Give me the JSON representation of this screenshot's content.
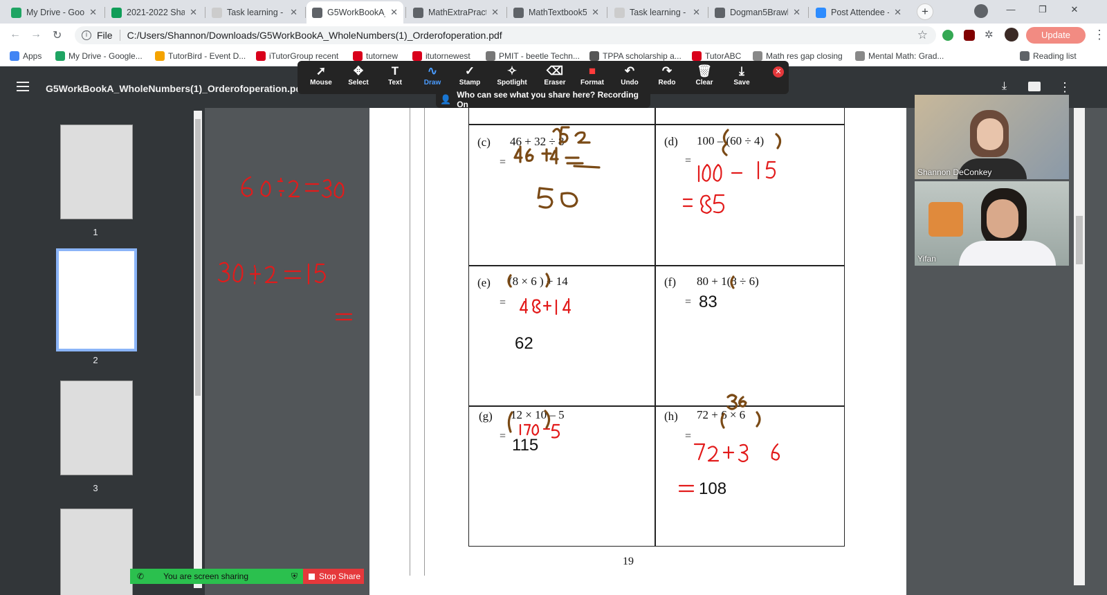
{
  "browser": {
    "tabs": [
      {
        "label": "My Drive - Goo",
        "color": "#1fa463"
      },
      {
        "label": "2021-2022 Sha",
        "color": "#0f9d58"
      },
      {
        "label": "Task learning -",
        "color": "#cccccc"
      },
      {
        "label": "G5WorkBookA_",
        "color": "#5f6368"
      },
      {
        "label": "MathExtraPract",
        "color": "#5f6368"
      },
      {
        "label": "MathTextbook5",
        "color": "#5f6368"
      },
      {
        "label": "Task learning -",
        "color": "#cccccc"
      },
      {
        "label": "Dogman5Brawl",
        "color": "#5f6368"
      },
      {
        "label": "Post Attendee -",
        "color": "#2d8cff"
      }
    ],
    "close_glyph": "✕",
    "new_tab": "+",
    "address": {
      "scheme_label": "File",
      "url": "C:/Users/Shannon/Downloads/G5WorkBookA_WholeNumbers(1)_Orderofoperation.pdf"
    },
    "update_button": "Update",
    "bookmarks": [
      {
        "label": "Apps",
        "color": "#4285f4"
      },
      {
        "label": "My Drive - Google...",
        "color": "#1fa463"
      },
      {
        "label": "TutorBird - Event D...",
        "color": "#f4a300"
      },
      {
        "label": "iTutorGroup recent",
        "color": "#d9001b"
      },
      {
        "label": "tutornew",
        "color": "#d9001b"
      },
      {
        "label": "itutornewest",
        "color": "#d9001b"
      },
      {
        "label": "PMIT - beetle Techn...",
        "color": "#777777"
      },
      {
        "label": "TPPA scholarship a...",
        "color": "#555555"
      },
      {
        "label": "TutorABC",
        "color": "#d9001b"
      },
      {
        "label": "Math res gap closing",
        "color": "#888888"
      },
      {
        "label": "Mental Math: Grad...",
        "color": "#888888"
      },
      {
        "label": "Reading list",
        "color": "#5f6368"
      }
    ]
  },
  "pdf": {
    "filename": "G5WorkBookA_WholeNumbers(1)_Orderofoperation.pdf",
    "thumbnails": [
      "1",
      "2",
      "3"
    ],
    "page_number": "19",
    "problems": {
      "c": {
        "label": "(c)",
        "expr": "46 + 32 ÷ 8",
        "eq": "="
      },
      "d": {
        "label": "(d)",
        "expr": "100 – (60 ÷ 4)",
        "eq": "="
      },
      "e": {
        "label": "(e)",
        "expr": "(8 × 6 ) + 14",
        "eq": "=",
        "answer": "62"
      },
      "f": {
        "label": "(f)",
        "expr": "80 + 1(8 ÷ 6)",
        "eq": "=",
        "answer": "83"
      },
      "g": {
        "label": "(g)",
        "expr": "12 × 10 – 5",
        "eq": "=",
        "answer": "115"
      },
      "h": {
        "label": "(h)",
        "expr": "72 + 6 × 6",
        "eq": "=",
        "answer": "108"
      }
    }
  },
  "zoom": {
    "tools": [
      "Mouse",
      "Select",
      "Text",
      "Draw",
      "Stamp",
      "Spotlight",
      "Eraser",
      "Format",
      "Undo",
      "Redo",
      "Clear",
      "Save"
    ],
    "active_tool": "Draw",
    "recording_notice": "Who can see what you share here? Recording On",
    "participants": [
      {
        "name": "Shannon DeConkey"
      },
      {
        "name": "Yifan"
      }
    ],
    "sharing_status": "You are screen sharing",
    "stop_share": "Stop Share"
  }
}
